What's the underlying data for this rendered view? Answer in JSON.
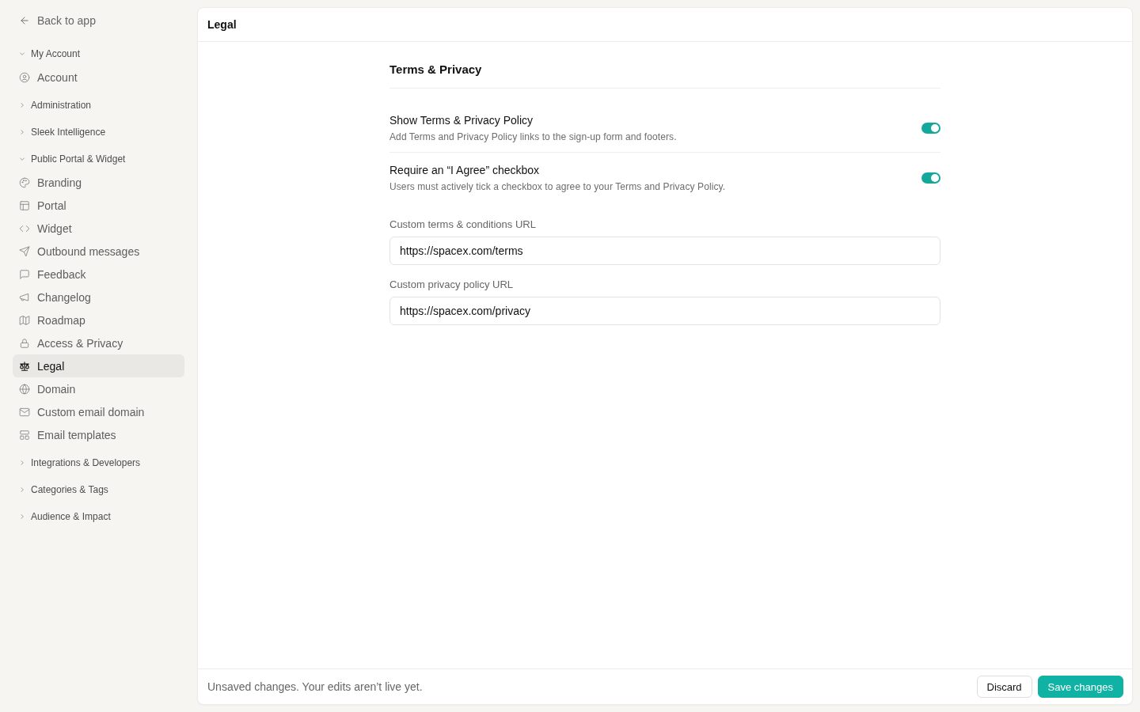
{
  "sidebar": {
    "back_link": {
      "label": "Back to app"
    },
    "groups": [
      {
        "label": "My Account",
        "expanded": true,
        "items": [
          {
            "label": "Account",
            "selected": false
          }
        ]
      },
      {
        "label": "Administration",
        "expanded": false
      },
      {
        "label": "Sleek Intelligence",
        "expanded": false
      },
      {
        "label": "Public Portal & Widget",
        "expanded": true,
        "items": [
          {
            "label": "Branding",
            "selected": false
          },
          {
            "label": "Portal",
            "selected": false
          },
          {
            "label": "Widget",
            "selected": false
          },
          {
            "label": "Outbound messages",
            "selected": false
          },
          {
            "label": "Feedback",
            "selected": false
          },
          {
            "label": "Changelog",
            "selected": false
          },
          {
            "label": "Roadmap",
            "selected": false
          },
          {
            "label": "Access & Privacy",
            "selected": false
          },
          {
            "label": "Legal",
            "selected": true
          },
          {
            "label": "Domain",
            "selected": false
          },
          {
            "label": "Custom email domain",
            "selected": false
          },
          {
            "label": "Email templates",
            "selected": false
          }
        ]
      },
      {
        "label": "Integrations & Developers",
        "expanded": false
      },
      {
        "label": "Categories & Tags",
        "expanded": false
      },
      {
        "label": "Audience & Impact",
        "expanded": false
      }
    ]
  },
  "panel": {
    "title": "Legal",
    "section": {
      "title": "Terms & Privacy",
      "toggles": [
        {
          "label": "Show Terms & Privacy Policy",
          "description": "Add Terms and Privacy Policy links to the sign-up form and footers.",
          "on": true
        },
        {
          "label": "Require an “I Agree” checkbox",
          "description": "Users must actively tick a checkbox to agree to your Terms and Privacy Policy.",
          "on": true
        }
      ],
      "fields": [
        {
          "label": "Custom terms & conditions URL",
          "value": "https://spacex.com/terms"
        },
        {
          "label": "Custom privacy policy URL",
          "value": "https://spacex.com/privacy"
        }
      ]
    }
  },
  "footer": {
    "message": "Unsaved changes. Your edits aren’t live yet.",
    "buttons": [
      {
        "label": "Discard",
        "kind": "secondary"
      },
      {
        "label": "Save changes",
        "kind": "primary"
      }
    ]
  }
}
